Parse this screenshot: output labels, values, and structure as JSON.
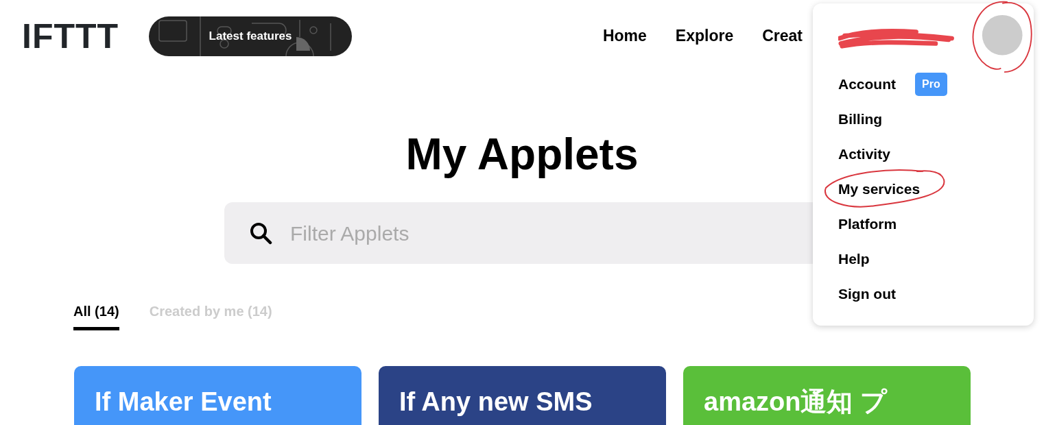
{
  "logo": "IFTTT",
  "promo": {
    "label": "Latest features"
  },
  "nav": [
    {
      "label": "Home"
    },
    {
      "label": "Explore"
    },
    {
      "label": "Creat"
    }
  ],
  "heading": "My Applets",
  "search": {
    "placeholder": "Filter Applets"
  },
  "tabs": [
    {
      "label": "All (14)",
      "selected": true
    },
    {
      "label": "Created by me (14)",
      "selected": false
    }
  ],
  "applets": [
    {
      "title": "If Maker Event",
      "color": "#4596f9"
    },
    {
      "title": "If Any new SMS",
      "color": "#2b4386"
    },
    {
      "title": "amazon通知 プ",
      "color": "#5abf3a"
    }
  ],
  "menu": {
    "items": [
      {
        "label": "Account",
        "badge": "Pro"
      },
      {
        "label": "Billing"
      },
      {
        "label": "Activity"
      },
      {
        "label": "My services",
        "circled": true
      },
      {
        "label": "Platform"
      },
      {
        "label": "Help"
      },
      {
        "label": "Sign out"
      }
    ]
  }
}
